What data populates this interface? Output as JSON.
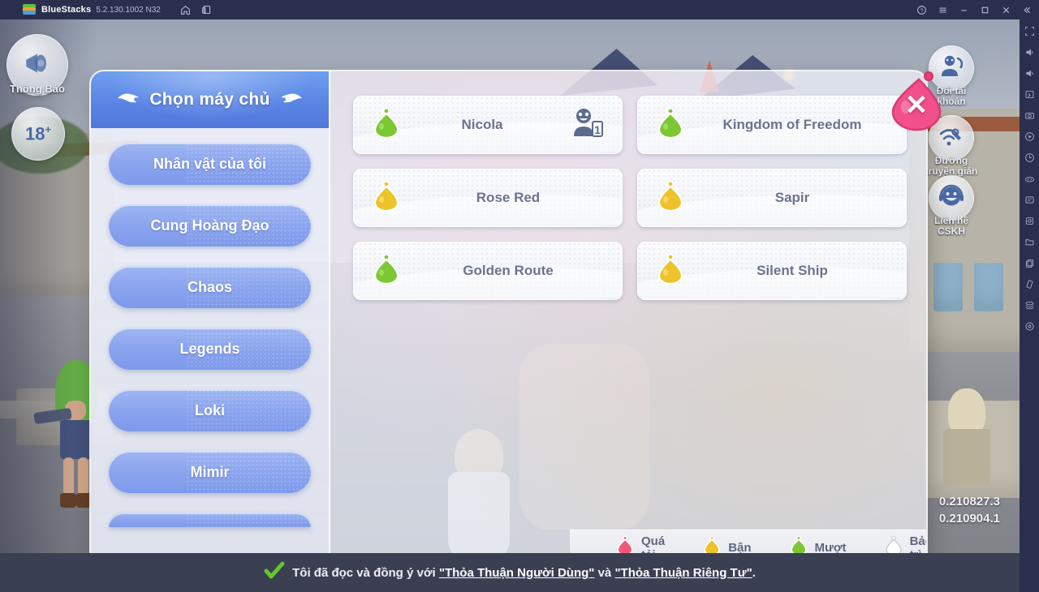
{
  "titlebar": {
    "app_name": "BlueStacks",
    "version": "5.2.130.1002 N32",
    "left_icons": [
      "home-icon",
      "multi-instance-icon"
    ],
    "right_icons": [
      "help-icon",
      "menu-icon",
      "minimize-icon",
      "maximize-icon",
      "close-icon",
      "collapse-icon"
    ]
  },
  "left_hud": {
    "notice": {
      "label": "Thông Báo",
      "icon": "megaphone-icon"
    },
    "age_rating": {
      "label": "18",
      "sup": "+"
    }
  },
  "right_hud": {
    "items": [
      {
        "label": "Đổi tài\nkhoản",
        "line1": "Đổi tài",
        "line2": "khoản",
        "icon": "switch-account-icon"
      },
      {
        "label": "Đường\ntruyền gián",
        "line1": "Đường",
        "line2": "truyền gián",
        "icon": "network-wrench-icon"
      },
      {
        "label": "Liên hệ\nCSKH",
        "line1": "Liên hệ",
        "line2": "CSKH",
        "icon": "customer-support-icon"
      }
    ]
  },
  "version_overlay": {
    "line1": "0.210827.3",
    "line2": "0.210904.1"
  },
  "dialog": {
    "header_title": "Chọn máy chủ",
    "header_icon_left": "wing-icon",
    "header_icon_right": "wing-icon",
    "close_label": "✕",
    "sidebar": {
      "items": [
        {
          "label": "Nhân vật của tôi"
        },
        {
          "label": "Cung Hoàng Đạo"
        },
        {
          "label": "Chaos"
        },
        {
          "label": "Legends"
        },
        {
          "label": "Loki"
        },
        {
          "label": "Mimir"
        }
      ]
    },
    "servers": [
      {
        "name": "Nicola",
        "status": "smooth",
        "status_color": "#7bc832",
        "has_character": true,
        "character_badge": "1"
      },
      {
        "name": "Kingdom of Freedom",
        "status": "smooth",
        "status_color": "#7bc832",
        "has_character": false,
        "character_badge": ""
      },
      {
        "name": "Rose Red",
        "status": "busy",
        "status_color": "#edc32a",
        "has_character": false,
        "character_badge": ""
      },
      {
        "name": "Sapir",
        "status": "busy",
        "status_color": "#edc32a",
        "has_character": false,
        "character_badge": ""
      },
      {
        "name": "Golden Route",
        "status": "smooth",
        "status_color": "#7bc832",
        "has_character": false,
        "character_badge": ""
      },
      {
        "name": "Silent Ship",
        "status": "busy",
        "status_color": "#edc32a",
        "has_character": false,
        "character_badge": ""
      }
    ],
    "legend": [
      {
        "label": "Quá tải",
        "color": "#f45a78"
      },
      {
        "label": "Bận",
        "color": "#edc32a"
      },
      {
        "label": "Mượt",
        "color": "#7bc832"
      },
      {
        "label": "Bảo trì",
        "color": "#ffffff"
      }
    ]
  },
  "agreement": {
    "check_icon": "green-check-icon",
    "prefix": "Tôi đã đọc và đồng ý với",
    "link1": "\"Thỏa Thuận Người Dùng\"",
    "conjunction": "và",
    "link2": "\"Thỏa Thuận Riêng Tư\"",
    "suffix": "."
  },
  "bs_sidebar": {
    "icons": [
      "fullscreen-icon",
      "volume-up-icon",
      "volume-down-icon",
      "keyboard-icon",
      "screenshot-icon",
      "record-icon",
      "rotate-icon",
      "gamepad-icon",
      "macro-icon",
      "eco-mode-icon",
      "folder-icon",
      "copy-icon",
      "shake-icon",
      "multi-instance-icon",
      "settings-icon"
    ]
  },
  "colors": {
    "accent_blue": "#5a85e4",
    "panel_bg": "#e8ecf6",
    "titlebar": "#2b2f4e",
    "agree_bar": "#3b3f52"
  }
}
